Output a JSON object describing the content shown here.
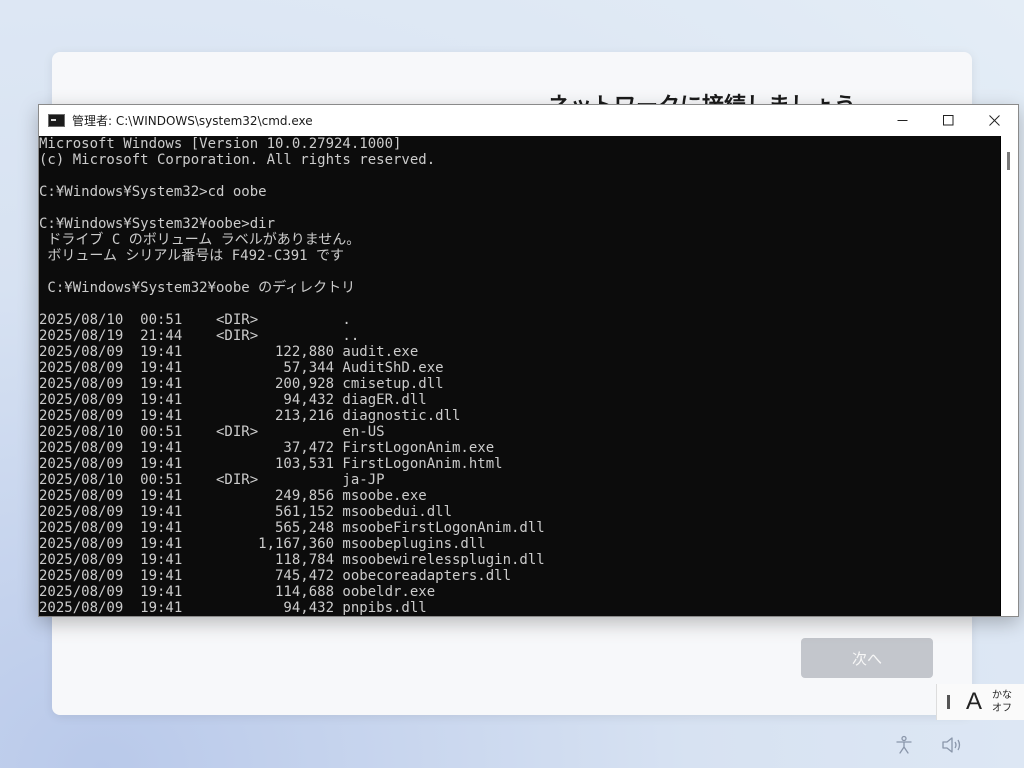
{
  "oobe": {
    "title": "ネットワークに接続しましょう",
    "next_button": "次へ"
  },
  "cmd": {
    "title": "管理者: C:\\WINDOWS\\system32\\cmd.exe",
    "lines": [
      "Microsoft Windows [Version 10.0.27924.1000]",
      "(c) Microsoft Corporation. All rights reserved.",
      "",
      "C:¥Windows¥System32>cd oobe",
      "",
      "C:¥Windows¥System32¥oobe>dir",
      " ドライブ C のボリューム ラベルがありません。",
      " ボリューム シリアル番号は F492-C391 です",
      "",
      " C:¥Windows¥System32¥oobe のディレクトリ",
      "",
      "2025/08/10  00:51    <DIR>          .",
      "2025/08/19  21:44    <DIR>          ..",
      "2025/08/09  19:41           122,880 audit.exe",
      "2025/08/09  19:41            57,344 AuditShD.exe",
      "2025/08/09  19:41           200,928 cmisetup.dll",
      "2025/08/09  19:41            94,432 diagER.dll",
      "2025/08/09  19:41           213,216 diagnostic.dll",
      "2025/08/10  00:51    <DIR>          en-US",
      "2025/08/09  19:41            37,472 FirstLogonAnim.exe",
      "2025/08/09  19:41           103,531 FirstLogonAnim.html",
      "2025/08/10  00:51    <DIR>          ja-JP",
      "2025/08/09  19:41           249,856 msoobe.exe",
      "2025/08/09  19:41           561,152 msoobedui.dll",
      "2025/08/09  19:41           565,248 msoobeFirstLogonAnim.dll",
      "2025/08/09  19:41         1,167,360 msoobeplugins.dll",
      "2025/08/09  19:41           118,784 msoobewirelessplugin.dll",
      "2025/08/09  19:41           745,472 oobecoreadapters.dll",
      "2025/08/09  19:41           114,688 oobeldr.exe",
      "2025/08/09  19:41            94,432 pnpibs.dll"
    ]
  },
  "ime": {
    "mode": "A",
    "line1": "かな",
    "line2": "オフ"
  },
  "icons": {
    "accessibility": "accessibility-icon",
    "volume": "volume-icon",
    "app": "cmd-app-icon"
  }
}
